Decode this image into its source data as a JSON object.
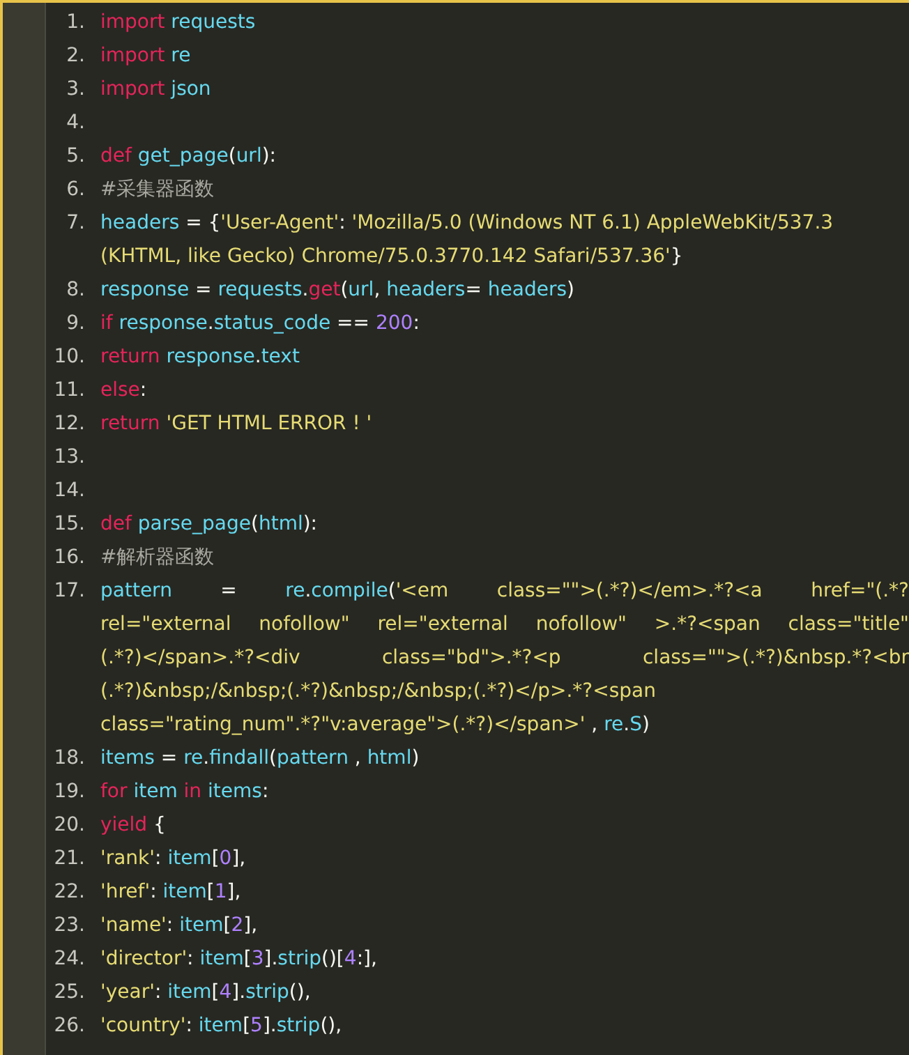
{
  "lines": [
    {
      "number": "1.",
      "rows": [
        {
          "justified": false,
          "tokens": [
            {
              "kind": "kw",
              "text": "import"
            },
            {
              "kind": "name",
              "text": " requests"
            }
          ]
        }
      ]
    },
    {
      "number": "2.",
      "rows": [
        {
          "justified": false,
          "tokens": [
            {
              "kind": "kw",
              "text": "import"
            },
            {
              "kind": "name",
              "text": " re"
            }
          ]
        }
      ]
    },
    {
      "number": "3.",
      "rows": [
        {
          "justified": false,
          "tokens": [
            {
              "kind": "kw",
              "text": "import"
            },
            {
              "kind": "name",
              "text": " json"
            }
          ]
        }
      ]
    },
    {
      "number": "4."
    },
    {
      "number": "5.",
      "rows": [
        {
          "justified": false,
          "tokens": [
            {
              "kind": "kw",
              "text": "def"
            },
            {
              "kind": "name",
              "text": " get_page"
            },
            {
              "kind": "plain",
              "text": "("
            },
            {
              "kind": "name",
              "text": "url"
            },
            {
              "kind": "plain",
              "text": "):"
            }
          ]
        }
      ]
    },
    {
      "number": "6.",
      "rows": [
        {
          "justified": false,
          "tokens": [
            {
              "kind": "comment",
              "text": "#采集器函数"
            }
          ]
        }
      ]
    },
    {
      "number": "7.",
      "rows": [
        {
          "justified": false,
          "tokens": [
            {
              "kind": "name",
              "text": "headers"
            },
            {
              "kind": "plain",
              "text": " = {"
            },
            {
              "kind": "str",
              "text": "'User-Agent'"
            },
            {
              "kind": "plain",
              "text": ": "
            },
            {
              "kind": "str",
              "text": "'Mozilla/5.0 (Windows NT 6.1) AppleWebKit/537.3"
            }
          ]
        },
        {
          "justified": false,
          "tokens": [
            {
              "kind": "str",
              "text": "(KHTML, like Gecko) Chrome/75.0.3770.142 Safari/537.36'"
            },
            {
              "kind": "plain",
              "text": "}"
            }
          ]
        }
      ]
    },
    {
      "number": "8.",
      "rows": [
        {
          "justified": false,
          "tokens": [
            {
              "kind": "name",
              "text": "response"
            },
            {
              "kind": "plain",
              "text": " = "
            },
            {
              "kind": "name",
              "text": "requests"
            },
            {
              "kind": "plain",
              "text": "."
            },
            {
              "kind": "kw",
              "text": "get"
            },
            {
              "kind": "plain",
              "text": "("
            },
            {
              "kind": "name",
              "text": "url"
            },
            {
              "kind": "plain",
              "text": ", "
            },
            {
              "kind": "name",
              "text": "headers"
            },
            {
              "kind": "plain",
              "text": "= "
            },
            {
              "kind": "name",
              "text": "headers"
            },
            {
              "kind": "plain",
              "text": ")"
            }
          ]
        }
      ]
    },
    {
      "number": "9.",
      "rows": [
        {
          "justified": false,
          "tokens": [
            {
              "kind": "kw",
              "text": "if"
            },
            {
              "kind": "name",
              "text": " response"
            },
            {
              "kind": "plain",
              "text": "."
            },
            {
              "kind": "name",
              "text": "status_code"
            },
            {
              "kind": "plain",
              "text": " == "
            },
            {
              "kind": "num",
              "text": "200"
            },
            {
              "kind": "plain",
              "text": ":"
            }
          ]
        }
      ]
    },
    {
      "number": "10.",
      "rows": [
        {
          "justified": false,
          "tokens": [
            {
              "kind": "kw",
              "text": "return"
            },
            {
              "kind": "name",
              "text": " response"
            },
            {
              "kind": "plain",
              "text": "."
            },
            {
              "kind": "name",
              "text": "text"
            }
          ]
        }
      ]
    },
    {
      "number": "11.",
      "rows": [
        {
          "justified": false,
          "tokens": [
            {
              "kind": "kw",
              "text": "else"
            },
            {
              "kind": "plain",
              "text": ":"
            }
          ]
        }
      ]
    },
    {
      "number": "12.",
      "rows": [
        {
          "justified": false,
          "tokens": [
            {
              "kind": "kw",
              "text": "return"
            },
            {
              "kind": "str",
              "text": " 'GET HTML ERROR ! '"
            }
          ]
        }
      ]
    },
    {
      "number": "13."
    },
    {
      "number": "14."
    },
    {
      "number": "15.",
      "rows": [
        {
          "justified": false,
          "tokens": [
            {
              "kind": "kw",
              "text": "def"
            },
            {
              "kind": "name",
              "text": " parse_page"
            },
            {
              "kind": "plain",
              "text": "("
            },
            {
              "kind": "name",
              "text": "html"
            },
            {
              "kind": "plain",
              "text": "):"
            }
          ]
        }
      ]
    },
    {
      "number": "16.",
      "rows": [
        {
          "justified": false,
          "tokens": [
            {
              "kind": "comment",
              "text": "#解析器函数"
            }
          ]
        }
      ]
    },
    {
      "number": "17.",
      "rows": [
        {
          "justified": true,
          "tokens": [
            {
              "kind": "name",
              "text": "pattern"
            },
            {
              "kind": "plain",
              "text": " = "
            },
            {
              "kind": "name",
              "text": "re"
            },
            {
              "kind": "plain",
              "text": "."
            },
            {
              "kind": "name",
              "text": "compile"
            },
            {
              "kind": "plain",
              "text": "("
            },
            {
              "kind": "str",
              "text": "'<em class=\"\">(.*?)</em>.*?<a href=\"(.*?"
            }
          ]
        },
        {
          "justified": true,
          "tokens": [
            {
              "kind": "str",
              "text": "rel=\"external nofollow\" rel=\"external nofollow\" >.*?<span class=\"title\""
            }
          ]
        },
        {
          "justified": true,
          "tokens": [
            {
              "kind": "str",
              "text": "(.*?)</span>.*?<div class=\"bd\">.*?<p class=\"\">(.*?)&nbsp.*?<br"
            }
          ]
        },
        {
          "justified": false,
          "tokens": [
            {
              "kind": "str",
              "text": "(.*?)&nbsp;/&nbsp;(.*?)&nbsp;/&nbsp;(.*?)</p>.*?<span"
            }
          ]
        },
        {
          "justified": false,
          "tokens": [
            {
              "kind": "str",
              "text": "class=\"rating_num\".*?\"v:average\">(.*?)</span>'"
            },
            {
              "kind": "plain",
              "text": " , "
            },
            {
              "kind": "name",
              "text": "re"
            },
            {
              "kind": "plain",
              "text": "."
            },
            {
              "kind": "name",
              "text": "S"
            },
            {
              "kind": "plain",
              "text": ")"
            }
          ]
        }
      ]
    },
    {
      "number": "18.",
      "rows": [
        {
          "justified": false,
          "tokens": [
            {
              "kind": "name",
              "text": "items"
            },
            {
              "kind": "plain",
              "text": " = "
            },
            {
              "kind": "name",
              "text": "re"
            },
            {
              "kind": "plain",
              "text": "."
            },
            {
              "kind": "name",
              "text": "findall"
            },
            {
              "kind": "plain",
              "text": "("
            },
            {
              "kind": "name",
              "text": "pattern"
            },
            {
              "kind": "plain",
              "text": " , "
            },
            {
              "kind": "name",
              "text": "html"
            },
            {
              "kind": "plain",
              "text": ")"
            }
          ]
        }
      ]
    },
    {
      "number": "19.",
      "rows": [
        {
          "justified": false,
          "tokens": [
            {
              "kind": "kw",
              "text": "for"
            },
            {
              "kind": "name",
              "text": " item"
            },
            {
              "kind": "kw",
              "text": " in"
            },
            {
              "kind": "name",
              "text": " items"
            },
            {
              "kind": "plain",
              "text": ":"
            }
          ]
        }
      ]
    },
    {
      "number": "20.",
      "rows": [
        {
          "justified": false,
          "tokens": [
            {
              "kind": "kw",
              "text": "yield"
            },
            {
              "kind": "plain",
              "text": " {"
            }
          ]
        }
      ]
    },
    {
      "number": "21.",
      "rows": [
        {
          "justified": false,
          "tokens": [
            {
              "kind": "str",
              "text": "'rank'"
            },
            {
              "kind": "plain",
              "text": ": "
            },
            {
              "kind": "name",
              "text": "item"
            },
            {
              "kind": "plain",
              "text": "["
            },
            {
              "kind": "num",
              "text": "0"
            },
            {
              "kind": "plain",
              "text": "],"
            }
          ]
        }
      ]
    },
    {
      "number": "22.",
      "rows": [
        {
          "justified": false,
          "tokens": [
            {
              "kind": "str",
              "text": "'href'"
            },
            {
              "kind": "plain",
              "text": ": "
            },
            {
              "kind": "name",
              "text": "item"
            },
            {
              "kind": "plain",
              "text": "["
            },
            {
              "kind": "num",
              "text": "1"
            },
            {
              "kind": "plain",
              "text": "],"
            }
          ]
        }
      ]
    },
    {
      "number": "23.",
      "rows": [
        {
          "justified": false,
          "tokens": [
            {
              "kind": "str",
              "text": "'name'"
            },
            {
              "kind": "plain",
              "text": ": "
            },
            {
              "kind": "name",
              "text": "item"
            },
            {
              "kind": "plain",
              "text": "["
            },
            {
              "kind": "num",
              "text": "2"
            },
            {
              "kind": "plain",
              "text": "],"
            }
          ]
        }
      ]
    },
    {
      "number": "24.",
      "rows": [
        {
          "justified": false,
          "tokens": [
            {
              "kind": "str",
              "text": "'director'"
            },
            {
              "kind": "plain",
              "text": ": "
            },
            {
              "kind": "name",
              "text": "item"
            },
            {
              "kind": "plain",
              "text": "["
            },
            {
              "kind": "num",
              "text": "3"
            },
            {
              "kind": "plain",
              "text": "]."
            },
            {
              "kind": "name",
              "text": "strip"
            },
            {
              "kind": "plain",
              "text": "()["
            },
            {
              "kind": "num",
              "text": "4"
            },
            {
              "kind": "plain",
              "text": ":],"
            }
          ]
        }
      ]
    },
    {
      "number": "25.",
      "rows": [
        {
          "justified": false,
          "tokens": [
            {
              "kind": "str",
              "text": "'year'"
            },
            {
              "kind": "plain",
              "text": ": "
            },
            {
              "kind": "name",
              "text": "item"
            },
            {
              "kind": "plain",
              "text": "["
            },
            {
              "kind": "num",
              "text": "4"
            },
            {
              "kind": "plain",
              "text": "]."
            },
            {
              "kind": "name",
              "text": "strip"
            },
            {
              "kind": "plain",
              "text": "(),"
            }
          ]
        }
      ]
    },
    {
      "number": "26.",
      "rows": [
        {
          "justified": false,
          "tokens": [
            {
              "kind": "str",
              "text": "'country'"
            },
            {
              "kind": "plain",
              "text": ": "
            },
            {
              "kind": "name",
              "text": "item"
            },
            {
              "kind": "plain",
              "text": "["
            },
            {
              "kind": "num",
              "text": "5"
            },
            {
              "kind": "plain",
              "text": "]."
            },
            {
              "kind": "name",
              "text": "strip"
            },
            {
              "kind": "plain",
              "text": "(),"
            }
          ]
        }
      ]
    }
  ]
}
